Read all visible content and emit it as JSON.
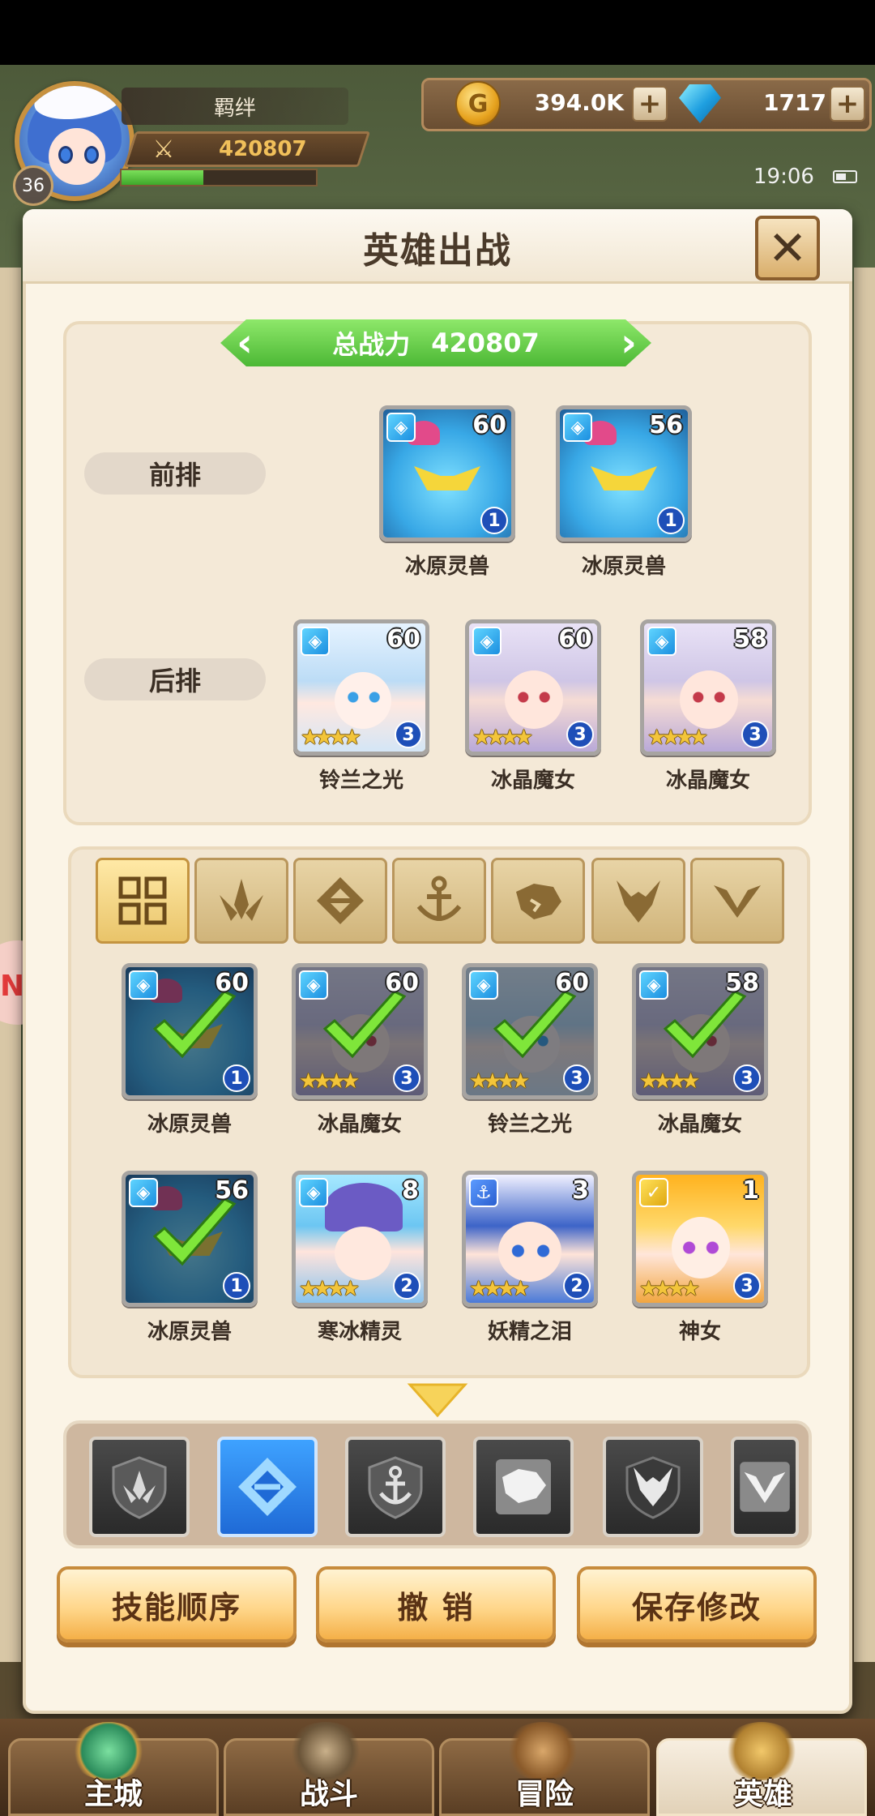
{
  "player": {
    "level": "36",
    "name": "羁绊",
    "power": "420807",
    "exp_fraction": 0.42
  },
  "currency": {
    "gold": "394.0K",
    "gems": "1717"
  },
  "status": {
    "time": "19:06"
  },
  "modal": {
    "title": "英雄出战",
    "close_label": "✕",
    "total_power_label": "总战力",
    "total_power_value": "420807",
    "front_row_label": "前排",
    "back_row_label": "后排"
  },
  "front_row": [
    {
      "name": "冰原灵兽",
      "level": "60",
      "stars": "1",
      "portrait": "beast",
      "faction": "ice"
    },
    {
      "name": "冰原灵兽",
      "level": "56",
      "stars": "1",
      "portrait": "beast",
      "faction": "ice"
    }
  ],
  "back_row": [
    {
      "name": "铃兰之光",
      "level": "60",
      "stars": "3",
      "portrait": "lily",
      "faction": "ice"
    },
    {
      "name": "冰晶魔女",
      "level": "60",
      "stars": "3",
      "portrait": "maid",
      "faction": "ice"
    },
    {
      "name": "冰晶魔女",
      "level": "58",
      "stars": "3",
      "portrait": "maid",
      "faction": "ice"
    }
  ],
  "filter_tabs": [
    "all-icon",
    "nature-icon",
    "ice-icon",
    "anchor-icon",
    "beast-icon",
    "demon-icon",
    "holy-icon"
  ],
  "roster": [
    {
      "name": "冰原灵兽",
      "level": "60",
      "stars": "1",
      "portrait": "beast",
      "faction": "ice",
      "deployed": true
    },
    {
      "name": "冰晶魔女",
      "level": "60",
      "stars": "3",
      "portrait": "maid",
      "faction": "ice",
      "deployed": true
    },
    {
      "name": "铃兰之光",
      "level": "60",
      "stars": "3",
      "portrait": "lily",
      "faction": "ice",
      "deployed": true
    },
    {
      "name": "冰晶魔女",
      "level": "58",
      "stars": "3",
      "portrait": "maid",
      "faction": "ice",
      "deployed": true
    },
    {
      "name": "冰原灵兽",
      "level": "56",
      "stars": "1",
      "portrait": "beast",
      "faction": "ice",
      "deployed": true
    },
    {
      "name": "寒冰精灵",
      "level": "8",
      "stars": "2",
      "portrait": "frost",
      "faction": "ice",
      "deployed": false
    },
    {
      "name": "妖精之泪",
      "level": "3",
      "stars": "2",
      "portrait": "fairy",
      "faction": "anchor",
      "deployed": false
    },
    {
      "name": "神女",
      "level": "1",
      "stars": "3",
      "portrait": "goddess",
      "faction": "holy",
      "deployed": false
    }
  ],
  "faction_strip": [
    "nature-shield-icon",
    "ice-crystal-icon",
    "anchor-shield-icon",
    "beast-shield-icon",
    "demon-shield-icon",
    "holy-shield-icon"
  ],
  "actions": {
    "skill_order": "技能顺序",
    "undo": "撤 销",
    "save": "保存修改"
  },
  "nav": {
    "city": "主城",
    "battle": "战斗",
    "adventure": "冒险",
    "heroes": "英雄"
  }
}
